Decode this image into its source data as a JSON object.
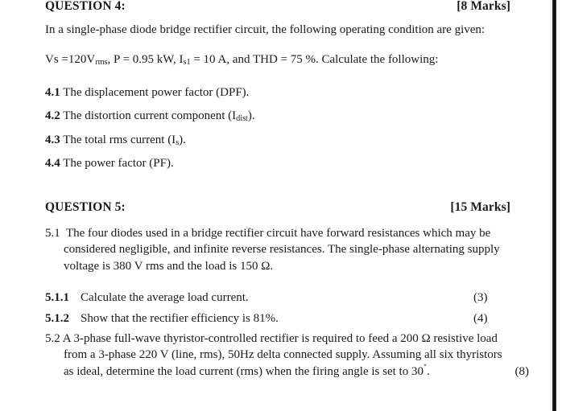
{
  "document": {
    "type": "exam-paper",
    "questions": [
      {
        "id": "question-4",
        "title": "QUESTION 4:",
        "marks": "[8 Marks]",
        "intro": "In a single-phase diode bridge rectifier circuit, the following operating condition are given:",
        "given": {
          "prefix": "Vs =120V",
          "sub1": "rms",
          "mid": ", P = 0.95 kW, I",
          "sub2": "s1",
          "suffix": " = 10 A, and THD = 75 %. Calculate the following:"
        },
        "items": [
          {
            "num": "4.1",
            "text": "The displacement power factor (DPF)."
          },
          {
            "num": "4.2",
            "text_before": "The distortion current component (I",
            "sub": "dist",
            "text_after": ")."
          },
          {
            "num": "4.3",
            "text_before": "The total rms current (I",
            "sub": "s",
            "text_after": ")."
          },
          {
            "num": "4.4",
            "text": "The power factor (PF)."
          }
        ]
      },
      {
        "id": "question-5",
        "title": "QUESTION 5:",
        "marks": "[15 Marks]",
        "items": [
          {
            "num": "5.1",
            "line1": "The four diodes used in a bridge rectifier circuit have forward resistances which may be",
            "line2": "considered negligible, and infinite reverse resistances. The single-phase alternating supply",
            "line3": "voltage is 380 V rms and the load is 150 Ω."
          },
          {
            "num": "5.1.1",
            "text": "Calculate the average load current.",
            "mark": "(3)"
          },
          {
            "num": "5.1.2",
            "text": "Show that the rectifier efficiency is 81%.",
            "mark": "(4)"
          },
          {
            "num": "5.2",
            "line1": "A 3-phase full-wave thyristor-controlled rectifier is required to feed a 200 Ω resistive load",
            "line2": "from a 3-phase 220 V (line, rms), 50Hz delta connected supply. Assuming all six thyristors",
            "line3_before": "as ideal, determine the load current (rms) when the firing angle is set to 30",
            "line3_degree": "˚",
            "line3_after": ".",
            "mark": "(8)"
          }
        ]
      }
    ]
  },
  "page": {
    "background_color": "#ffffff",
    "text_color": "#1a1a1a",
    "scan_edge_color": "#111111"
  }
}
